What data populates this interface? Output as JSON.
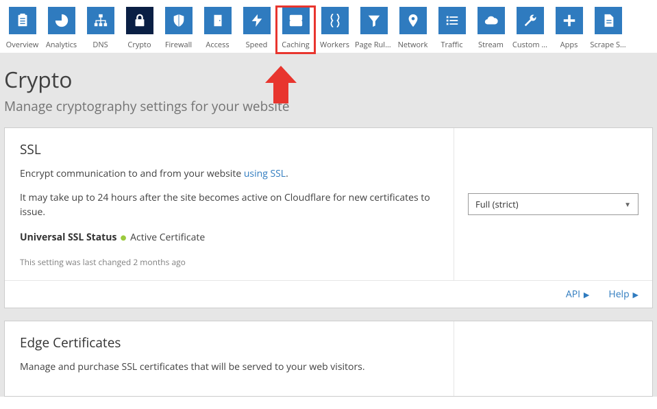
{
  "nav": {
    "tabs": [
      {
        "label": "Overview",
        "icon": "clipboard",
        "active": false
      },
      {
        "label": "Analytics",
        "icon": "pie",
        "active": false
      },
      {
        "label": "DNS",
        "icon": "sitemap",
        "active": false
      },
      {
        "label": "Crypto",
        "icon": "lock",
        "active": true
      },
      {
        "label": "Firewall",
        "icon": "shield",
        "active": false
      },
      {
        "label": "Access",
        "icon": "door",
        "active": false
      },
      {
        "label": "Speed",
        "icon": "bolt",
        "active": false
      },
      {
        "label": "Caching",
        "icon": "drive",
        "active": false,
        "highlighted": true
      },
      {
        "label": "Workers",
        "icon": "braces",
        "active": false
      },
      {
        "label": "Page Rules",
        "icon": "funnel",
        "active": false
      },
      {
        "label": "Network",
        "icon": "pin",
        "active": false
      },
      {
        "label": "Traffic",
        "icon": "list",
        "active": false
      },
      {
        "label": "Stream",
        "icon": "cloud",
        "active": false
      },
      {
        "label": "Custom ...",
        "icon": "wrench",
        "active": false
      },
      {
        "label": "Apps",
        "icon": "plus",
        "active": false
      },
      {
        "label": "Scrape S...",
        "icon": "filetext",
        "active": false
      }
    ]
  },
  "page": {
    "title": "Crypto",
    "subtitle": "Manage cryptography settings for your website"
  },
  "ssl_card": {
    "title": "SSL",
    "intro": "Encrypt communication to and from your website ",
    "link": "using SSL",
    "period": ".",
    "note": "It may take up to 24 hours after the site becomes active on Cloudflare for new certificates to issue.",
    "status_label": "Universal SSL Status",
    "status_value": "Active Certificate",
    "meta": "This setting was last changed 2 months ago",
    "select_value": "Full (strict)",
    "footer": {
      "api": "API",
      "help": "Help"
    }
  },
  "edge_card": {
    "title": "Edge Certificates",
    "intro": "Manage and purchase SSL certificates that will be served to your web visitors."
  }
}
